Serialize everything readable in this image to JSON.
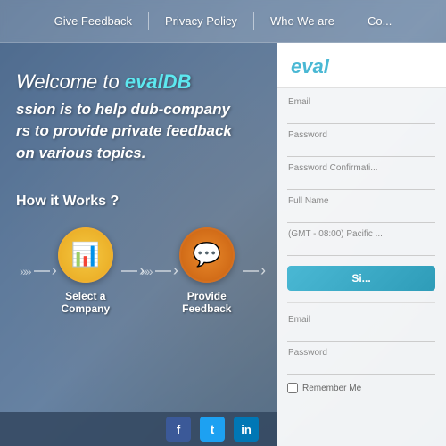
{
  "nav": {
    "items": [
      {
        "id": "give-feedback",
        "label": "Give Feedback"
      },
      {
        "id": "privacy-policy",
        "label": "Privacy Policy"
      },
      {
        "id": "who-we-are",
        "label": "Who We are"
      },
      {
        "id": "contact",
        "label": "Co..."
      }
    ]
  },
  "hero": {
    "welcome_prefix": "Welcome to ",
    "brand_name": "evalDB",
    "tagline_line1": "ssion is to help dub-company",
    "tagline_line2": "rs to provide private feedback",
    "tagline_line3": "on various topics."
  },
  "how_it_works": {
    "title": "How it Works ?",
    "steps": [
      {
        "id": "select-company",
        "label": "Select a Company",
        "icon": "📊",
        "style": "yellow"
      },
      {
        "id": "provide-feedback",
        "label": "Provide Feedback",
        "icon": "💬",
        "style": "orange"
      }
    ]
  },
  "signup_panel": {
    "brand": "eval",
    "fields": {
      "email_label": "Email",
      "password_label": "Password",
      "password_confirm_label": "Password Confirmati...",
      "fullname_label": "Full Name",
      "timezone_label": "(GMT - 08:00) Pacific ...",
      "signup_button": "Si..."
    },
    "login_section": {
      "email_label": "Email",
      "password_label": "Password",
      "remember_me_label": "Remember Me"
    }
  },
  "footer": {
    "social": [
      {
        "id": "facebook",
        "label": "f"
      },
      {
        "id": "twitter",
        "label": "t"
      },
      {
        "id": "linkedin",
        "label": "in"
      }
    ]
  }
}
